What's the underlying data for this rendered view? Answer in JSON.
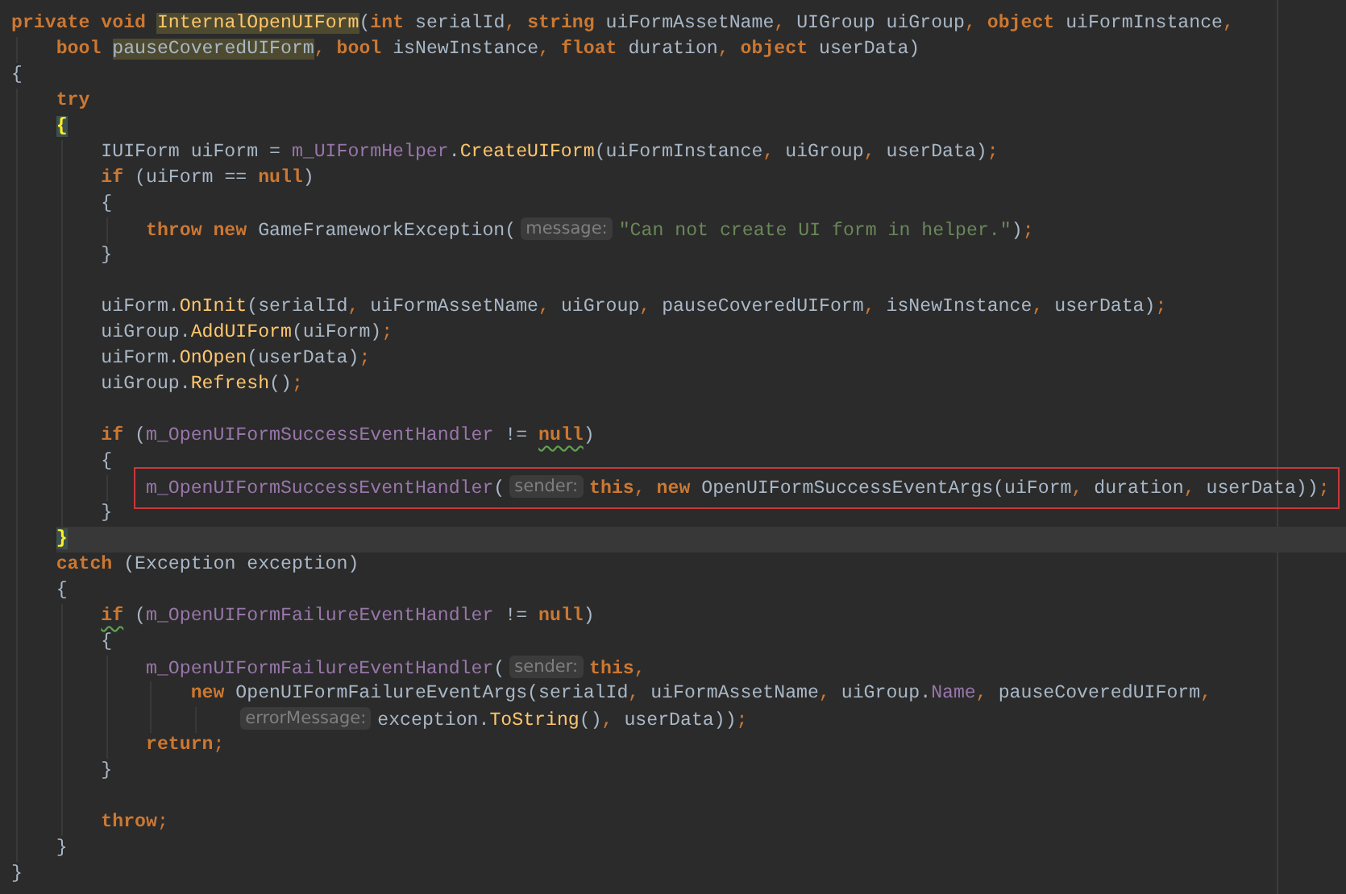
{
  "editor": {
    "lines": [
      {
        "kind": "code",
        "tokens": [
          {
            "text": "private void ",
            "kind": "kw"
          },
          {
            "text": "InternalOpenUIForm",
            "kind": "fn",
            "highlighted": true
          },
          {
            "text": "(",
            "kind": "id"
          },
          {
            "text": "int ",
            "kind": "kw"
          },
          {
            "text": "serialId",
            "kind": "id"
          },
          {
            "text": ", ",
            "kind": "p"
          },
          {
            "text": "string ",
            "kind": "kw"
          },
          {
            "text": "uiFormAssetName",
            "kind": "id"
          },
          {
            "text": ", ",
            "kind": "p"
          },
          {
            "text": "UIGroup uiGroup",
            "kind": "id"
          },
          {
            "text": ", ",
            "kind": "p"
          },
          {
            "text": "object ",
            "kind": "kw"
          },
          {
            "text": "uiFormInstance",
            "kind": "id"
          },
          {
            "text": ",",
            "kind": "p"
          }
        ],
        "children": [
          {
            "kind": "code",
            "tokens": [
              {
                "text": "bool ",
                "kind": "kw"
              },
              {
                "text": "pauseCoveredUIForm",
                "kind": "id",
                "highlighted": true
              },
              {
                "text": ", ",
                "kind": "p"
              },
              {
                "text": "bool ",
                "kind": "kw"
              },
              {
                "text": "isNewInstance",
                "kind": "id"
              },
              {
                "text": ", ",
                "kind": "p"
              },
              {
                "text": "float ",
                "kind": "kw"
              },
              {
                "text": "duration",
                "kind": "id"
              },
              {
                "text": ", ",
                "kind": "p"
              },
              {
                "text": "object ",
                "kind": "kw"
              },
              {
                "text": "userData)",
                "kind": "id"
              }
            ]
          }
        ]
      },
      {
        "kind": "code",
        "tokens": [
          {
            "text": "{",
            "kind": "id"
          }
        ],
        "children": [
          {
            "kind": "code",
            "tokens": [
              {
                "text": "try",
                "kind": "kw"
              }
            ]
          },
          {
            "kind": "code",
            "tokens": [
              {
                "text": "{",
                "kind": "id",
                "match": true
              }
            ],
            "children": [
              {
                "kind": "code",
                "tokens": [
                  {
                    "text": "IUIForm uiForm = ",
                    "kind": "id"
                  },
                  {
                    "text": "m_UIFormHelper",
                    "kind": "fld"
                  },
                  {
                    "text": ".",
                    "kind": "id"
                  },
                  {
                    "text": "CreateUIForm",
                    "kind": "fn"
                  },
                  {
                    "text": "(uiFormInstance",
                    "kind": "id"
                  },
                  {
                    "text": ", ",
                    "kind": "p"
                  },
                  {
                    "text": "uiGroup",
                    "kind": "id"
                  },
                  {
                    "text": ", ",
                    "kind": "p"
                  },
                  {
                    "text": "userData)",
                    "kind": "id"
                  },
                  {
                    "text": ";",
                    "kind": "p"
                  }
                ]
              },
              {
                "kind": "code",
                "tokens": [
                  {
                    "text": "if ",
                    "kind": "kw"
                  },
                  {
                    "text": "(uiForm == ",
                    "kind": "id"
                  },
                  {
                    "text": "null",
                    "kind": "kw"
                  },
                  {
                    "text": ")",
                    "kind": "id"
                  }
                ]
              },
              {
                "kind": "code",
                "tokens": [
                  {
                    "text": "{",
                    "kind": "id"
                  }
                ],
                "children": [
                  {
                    "kind": "code",
                    "tokens": [
                      {
                        "text": "throw new ",
                        "kind": "kw"
                      },
                      {
                        "text": "GameFrameworkException(",
                        "kind": "id"
                      },
                      {
                        "text": "message:",
                        "kind": "hint"
                      },
                      {
                        "text": "\"Can not create UI form in helper.\"",
                        "kind": "str"
                      },
                      {
                        "text": ")",
                        "kind": "id"
                      },
                      {
                        "text": ";",
                        "kind": "p"
                      }
                    ]
                  }
                ]
              },
              {
                "kind": "code",
                "tokens": [
                  {
                    "text": "}",
                    "kind": "id"
                  }
                ]
              },
              {
                "kind": "blank"
              },
              {
                "kind": "code",
                "tokens": [
                  {
                    "text": "uiForm.",
                    "kind": "id"
                  },
                  {
                    "text": "OnInit",
                    "kind": "fn"
                  },
                  {
                    "text": "(serialId",
                    "kind": "id"
                  },
                  {
                    "text": ", ",
                    "kind": "p"
                  },
                  {
                    "text": "uiFormAssetName",
                    "kind": "id"
                  },
                  {
                    "text": ", ",
                    "kind": "p"
                  },
                  {
                    "text": "uiGroup",
                    "kind": "id"
                  },
                  {
                    "text": ", ",
                    "kind": "p"
                  },
                  {
                    "text": "pauseCoveredUIForm",
                    "kind": "id"
                  },
                  {
                    "text": ", ",
                    "kind": "p"
                  },
                  {
                    "text": "isNewInstance",
                    "kind": "id"
                  },
                  {
                    "text": ", ",
                    "kind": "p"
                  },
                  {
                    "text": "userData)",
                    "kind": "id"
                  },
                  {
                    "text": ";",
                    "kind": "p"
                  }
                ]
              },
              {
                "kind": "code",
                "tokens": [
                  {
                    "text": "uiGroup.",
                    "kind": "id"
                  },
                  {
                    "text": "AddUIForm",
                    "kind": "fn"
                  },
                  {
                    "text": "(uiForm)",
                    "kind": "id"
                  },
                  {
                    "text": ";",
                    "kind": "p"
                  }
                ]
              },
              {
                "kind": "code",
                "tokens": [
                  {
                    "text": "uiForm.",
                    "kind": "id"
                  },
                  {
                    "text": "OnOpen",
                    "kind": "fn"
                  },
                  {
                    "text": "(userData)",
                    "kind": "id"
                  },
                  {
                    "text": ";",
                    "kind": "p"
                  }
                ]
              },
              {
                "kind": "code",
                "tokens": [
                  {
                    "text": "uiGroup.",
                    "kind": "id"
                  },
                  {
                    "text": "Refresh",
                    "kind": "fn"
                  },
                  {
                    "text": "()",
                    "kind": "id"
                  },
                  {
                    "text": ";",
                    "kind": "p"
                  }
                ]
              },
              {
                "kind": "blank"
              },
              {
                "kind": "code",
                "tokens": [
                  {
                    "text": "if ",
                    "kind": "kw"
                  },
                  {
                    "text": "(",
                    "kind": "id"
                  },
                  {
                    "text": "m_OpenUIFormSuccessEventHandler",
                    "kind": "fld"
                  },
                  {
                    "text": " != ",
                    "kind": "id"
                  },
                  {
                    "text": "null",
                    "kind": "kw",
                    "warning": true
                  },
                  {
                    "text": ")",
                    "kind": "id"
                  }
                ]
              },
              {
                "kind": "code",
                "tokens": [
                  {
                    "text": "{",
                    "kind": "id"
                  }
                ],
                "children": [
                  {
                    "kind": "code",
                    "boxed": true,
                    "tokens": [
                      {
                        "text": "m_OpenUIFormSuccessEventHandler",
                        "kind": "fld"
                      },
                      {
                        "text": "(",
                        "kind": "id"
                      },
                      {
                        "text": "sender:",
                        "kind": "hint"
                      },
                      {
                        "text": "this",
                        "kind": "kw"
                      },
                      {
                        "text": ", ",
                        "kind": "p"
                      },
                      {
                        "text": "new ",
                        "kind": "kw"
                      },
                      {
                        "text": "OpenUIFormSuccessEventArgs(uiForm",
                        "kind": "id"
                      },
                      {
                        "text": ", ",
                        "kind": "p"
                      },
                      {
                        "text": "duration",
                        "kind": "id"
                      },
                      {
                        "text": ", ",
                        "kind": "p"
                      },
                      {
                        "text": "userData))",
                        "kind": "id"
                      },
                      {
                        "text": ";",
                        "kind": "p"
                      }
                    ]
                  }
                ]
              },
              {
                "kind": "code",
                "tokens": [
                  {
                    "text": "}",
                    "kind": "id"
                  }
                ]
              }
            ]
          },
          {
            "kind": "code",
            "current": true,
            "tokens": [
              {
                "text": "}",
                "kind": "id",
                "match": true
              }
            ]
          },
          {
            "kind": "code",
            "tokens": [
              {
                "text": "catch ",
                "kind": "kw"
              },
              {
                "text": "(Exception exception)",
                "kind": "id"
              }
            ]
          },
          {
            "kind": "code",
            "tokens": [
              {
                "text": "{",
                "kind": "id"
              }
            ],
            "children": [
              {
                "kind": "code",
                "tokens": [
                  {
                    "text": "if",
                    "kind": "kw",
                    "warning": true
                  },
                  {
                    "text": " (",
                    "kind": "id"
                  },
                  {
                    "text": "m_OpenUIFormFailureEventHandler",
                    "kind": "fld"
                  },
                  {
                    "text": " != ",
                    "kind": "id"
                  },
                  {
                    "text": "null",
                    "kind": "kw"
                  },
                  {
                    "text": ")",
                    "kind": "id"
                  }
                ]
              },
              {
                "kind": "code",
                "tokens": [
                  {
                    "text": "{",
                    "kind": "id"
                  }
                ],
                "children": [
                  {
                    "kind": "code",
                    "tokens": [
                      {
                        "text": "m_OpenUIFormFailureEventHandler",
                        "kind": "fld"
                      },
                      {
                        "text": "(",
                        "kind": "id"
                      },
                      {
                        "text": "sender:",
                        "kind": "hint"
                      },
                      {
                        "text": "this",
                        "kind": "kw"
                      },
                      {
                        "text": ",",
                        "kind": "p"
                      }
                    ],
                    "children": [
                      {
                        "kind": "code",
                        "tokens": [
                          {
                            "text": "new ",
                            "kind": "kw"
                          },
                          {
                            "text": "OpenUIFormFailureEventArgs(serialId",
                            "kind": "id"
                          },
                          {
                            "text": ", ",
                            "kind": "p"
                          },
                          {
                            "text": "uiFormAssetName",
                            "kind": "id"
                          },
                          {
                            "text": ", ",
                            "kind": "p"
                          },
                          {
                            "text": "uiGroup.",
                            "kind": "id"
                          },
                          {
                            "text": "Name",
                            "kind": "fld"
                          },
                          {
                            "text": ", ",
                            "kind": "p"
                          },
                          {
                            "text": "pauseCoveredUIForm",
                            "kind": "id"
                          },
                          {
                            "text": ",",
                            "kind": "p"
                          }
                        ],
                        "children": [
                          {
                            "kind": "code",
                            "tokens": [
                              {
                                "text": "errorMessage:",
                                "kind": "hint"
                              },
                              {
                                "text": "exception.",
                                "kind": "id"
                              },
                              {
                                "text": "ToString",
                                "kind": "fn"
                              },
                              {
                                "text": "()",
                                "kind": "id"
                              },
                              {
                                "text": ", ",
                                "kind": "p"
                              },
                              {
                                "text": "userData))",
                                "kind": "id"
                              },
                              {
                                "text": ";",
                                "kind": "p"
                              }
                            ]
                          }
                        ]
                      }
                    ]
                  },
                  {
                    "kind": "code",
                    "tokens": [
                      {
                        "text": "return",
                        "kind": "kw"
                      },
                      {
                        "text": ";",
                        "kind": "p"
                      }
                    ]
                  }
                ]
              },
              {
                "kind": "code",
                "tokens": [
                  {
                    "text": "}",
                    "kind": "id"
                  }
                ]
              },
              {
                "kind": "blank"
              },
              {
                "kind": "code",
                "tokens": [
                  {
                    "text": "throw",
                    "kind": "kw"
                  },
                  {
                    "text": ";",
                    "kind": "p"
                  }
                ]
              }
            ]
          },
          {
            "kind": "code",
            "tokens": [
              {
                "text": "}",
                "kind": "id"
              }
            ]
          }
        ]
      },
      {
        "kind": "code",
        "tokens": [
          {
            "text": "}",
            "kind": "id"
          }
        ]
      }
    ]
  }
}
